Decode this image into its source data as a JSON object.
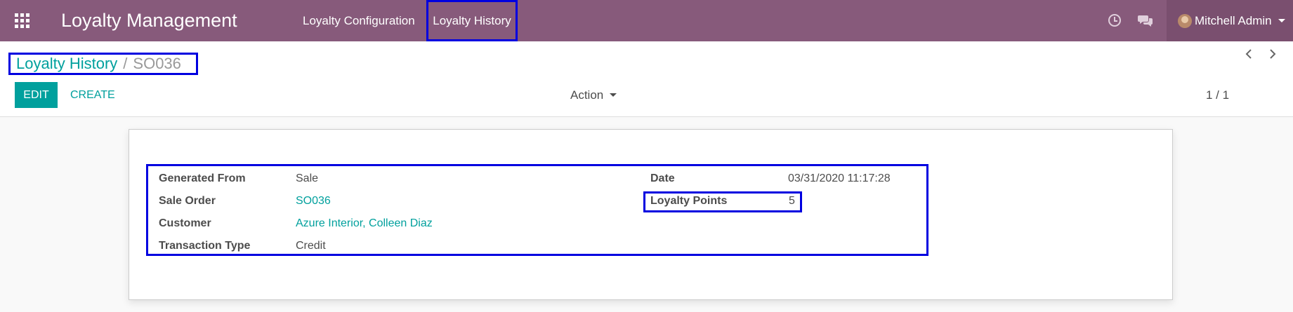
{
  "navbar": {
    "brand": "Loyalty Management",
    "menu": [
      "Loyalty Configuration",
      "Loyalty History"
    ],
    "user_name": "Mitchell Admin"
  },
  "breadcrumb": {
    "parent": "Loyalty History",
    "separator": "/",
    "current": "SO036"
  },
  "toolbar": {
    "edit_label": "EDIT",
    "create_label": "CREATE",
    "action_label": "Action",
    "pager_text": "1 / 1"
  },
  "form": {
    "left": [
      {
        "label": "Generated From",
        "value": "Sale"
      },
      {
        "label": "Sale Order",
        "value": "SO036"
      },
      {
        "label": "Customer",
        "value": "Azure Interior, Colleen Diaz"
      },
      {
        "label": "Transaction Type",
        "value": "Credit"
      }
    ],
    "right": [
      {
        "label": "Date",
        "value": "03/31/2020 11:17:28"
      },
      {
        "label": "Loyalty Points",
        "value": "5"
      }
    ]
  },
  "colors": {
    "navbar": "#875a7b",
    "accent": "#00a09d",
    "highlight_border": "#0000e0"
  }
}
